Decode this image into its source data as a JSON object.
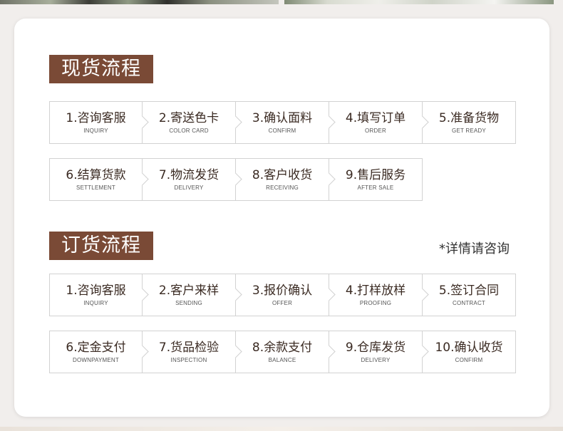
{
  "spot_section": {
    "title": "现货流程",
    "rows": [
      [
        {
          "label": "1.咨询客服",
          "sub": "INQUIRY"
        },
        {
          "label": "2.寄送色卡",
          "sub": "COLOR CARD"
        },
        {
          "label": "3.确认面料",
          "sub": "CONFIRM"
        },
        {
          "label": "4.填写订单",
          "sub": "ORDER"
        },
        {
          "label": "5.准备货物",
          "sub": "GET READY"
        }
      ],
      [
        {
          "label": "6.结算货款",
          "sub": "SETTLEMENT"
        },
        {
          "label": "7.物流发货",
          "sub": "DELIVERY"
        },
        {
          "label": "8.客户收货",
          "sub": "RECEIVING"
        },
        {
          "label": "9.售后服务",
          "sub": "AFTER SALE"
        }
      ]
    ]
  },
  "order_section": {
    "title": "订货流程",
    "note": "*详情请咨询",
    "rows": [
      [
        {
          "label": "1.咨询客服",
          "sub": "INQUIRY"
        },
        {
          "label": "2.客户来样",
          "sub": "SENDING"
        },
        {
          "label": "3.报价确认",
          "sub": "OFFER"
        },
        {
          "label": "4.打样放样",
          "sub": "PROOFING"
        },
        {
          "label": "5.签订合同",
          "sub": "CONTRACT"
        }
      ],
      [
        {
          "label": "6.定金支付",
          "sub": "DOWNPAYMENT"
        },
        {
          "label": "7.货品检验",
          "sub": "INSPECTION"
        },
        {
          "label": "8.余款支付",
          "sub": "BALANCE"
        },
        {
          "label": "9.仓库发货",
          "sub": "DELIVERY"
        },
        {
          "label": "10.确认收货",
          "sub": "CONFIRM"
        }
      ]
    ]
  },
  "colors": {
    "title_bg": "#7a4a36",
    "border": "#d2d2d2",
    "page_bg": "#f1eeec"
  }
}
